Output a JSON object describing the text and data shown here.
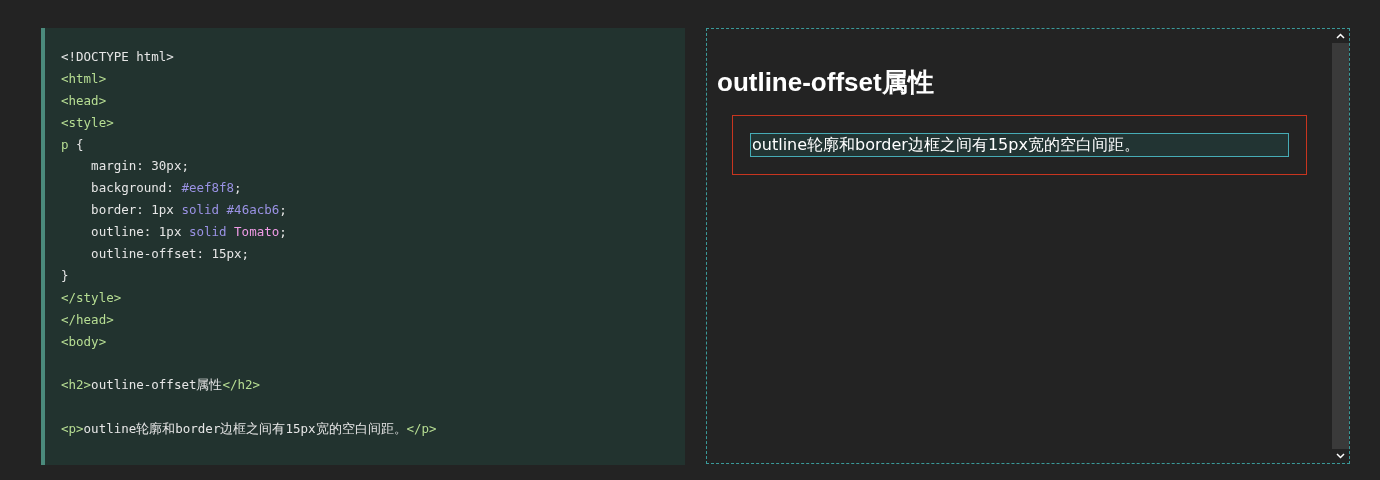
{
  "code_editor": {
    "lines": [
      {
        "kind": "code",
        "tokens": [
          {
            "kind": "plain",
            "text": "<!DOCTYPE html>"
          }
        ]
      },
      {
        "kind": "code",
        "tokens": [
          {
            "kind": "tag",
            "text": "<html>"
          }
        ]
      },
      {
        "kind": "code",
        "tokens": [
          {
            "kind": "tag",
            "text": "<head>"
          }
        ]
      },
      {
        "kind": "code",
        "tokens": [
          {
            "kind": "tag",
            "text": "<style>"
          }
        ]
      },
      {
        "kind": "code",
        "tokens": [
          {
            "kind": "tag",
            "text": "p"
          },
          {
            "kind": "plain",
            "text": " {"
          }
        ]
      },
      {
        "kind": "code",
        "tokens": [
          {
            "kind": "plain",
            "text": "    margin: 30px;"
          }
        ]
      },
      {
        "kind": "code",
        "tokens": [
          {
            "kind": "plain",
            "text": "    background: "
          },
          {
            "kind": "value",
            "text": "#eef8f8"
          },
          {
            "kind": "plain",
            "text": ";"
          }
        ]
      },
      {
        "kind": "code",
        "tokens": [
          {
            "kind": "plain",
            "text": "    border: 1px "
          },
          {
            "kind": "value",
            "text": "solid #46acb6"
          },
          {
            "kind": "plain",
            "text": ";"
          }
        ]
      },
      {
        "kind": "code",
        "tokens": [
          {
            "kind": "plain",
            "text": "    outline: 1px "
          },
          {
            "kind": "value",
            "text": "solid "
          },
          {
            "kind": "color",
            "text": "Tomato"
          },
          {
            "kind": "plain",
            "text": ";"
          }
        ]
      },
      {
        "kind": "code",
        "tokens": [
          {
            "kind": "plain",
            "text": "    outline-offset: 15px;"
          }
        ]
      },
      {
        "kind": "code",
        "tokens": [
          {
            "kind": "plain",
            "text": "}"
          }
        ]
      },
      {
        "kind": "code",
        "tokens": [
          {
            "kind": "tag",
            "text": "</style>"
          }
        ]
      },
      {
        "kind": "code",
        "tokens": [
          {
            "kind": "tag",
            "text": "</head>"
          }
        ]
      },
      {
        "kind": "code",
        "tokens": [
          {
            "kind": "tag",
            "text": "<body>"
          }
        ]
      },
      {
        "kind": "blank"
      },
      {
        "kind": "code",
        "tokens": [
          {
            "kind": "tag",
            "text": "<h2>"
          },
          {
            "kind": "plain",
            "text": "outline-offset属性"
          },
          {
            "kind": "tag",
            "text": "</h2>"
          }
        ]
      },
      {
        "kind": "blank"
      },
      {
        "kind": "code",
        "tokens": [
          {
            "kind": "tag",
            "text": "<p>"
          },
          {
            "kind": "plain",
            "text": "outline轮廓和border边框之间有15px宽的空白间距。"
          },
          {
            "kind": "tag",
            "text": "</p>"
          }
        ]
      }
    ]
  },
  "preview": {
    "heading": "outline-offset属性",
    "paragraph": "outline轮廓和border边框之间有15px宽的空白间距。"
  }
}
